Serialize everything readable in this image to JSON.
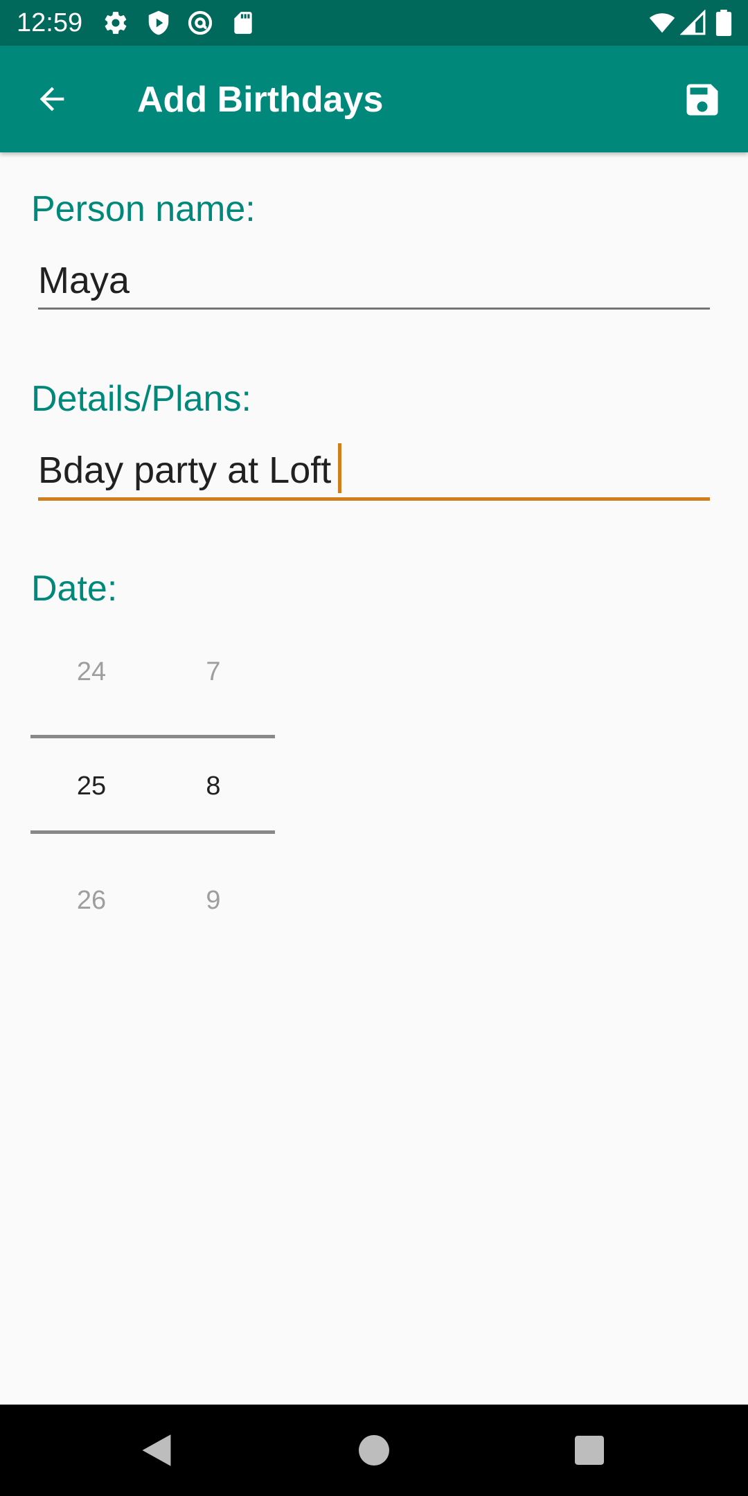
{
  "status_bar": {
    "time": "12:59",
    "left_icons": [
      "settings-icon",
      "shield-icon",
      "at-sign-icon",
      "sd-card-icon"
    ],
    "right_icons": [
      "wifi-icon",
      "signal-icon",
      "battery-icon"
    ]
  },
  "app_bar": {
    "title": "Add Birthdays",
    "back_icon": "arrow-back-icon",
    "save_icon": "save-icon",
    "color": "#00897b"
  },
  "form": {
    "person_name": {
      "label": "Person name:",
      "value": "Maya"
    },
    "details": {
      "label": "Details/Plans:",
      "value": "Bday party at Loft"
    },
    "date": {
      "label": "Date:",
      "day_picker": {
        "above": "24",
        "selected": "25",
        "below": "26"
      },
      "month_picker": {
        "above": "7",
        "selected": "8",
        "below": "9"
      }
    }
  },
  "nav_bar": {
    "icons": [
      "back-triangle-icon",
      "home-circle-icon",
      "recents-square-icon"
    ]
  },
  "colors": {
    "accent": "#00897b",
    "focus": "#d17f1c",
    "status_bar": "#00695c"
  }
}
